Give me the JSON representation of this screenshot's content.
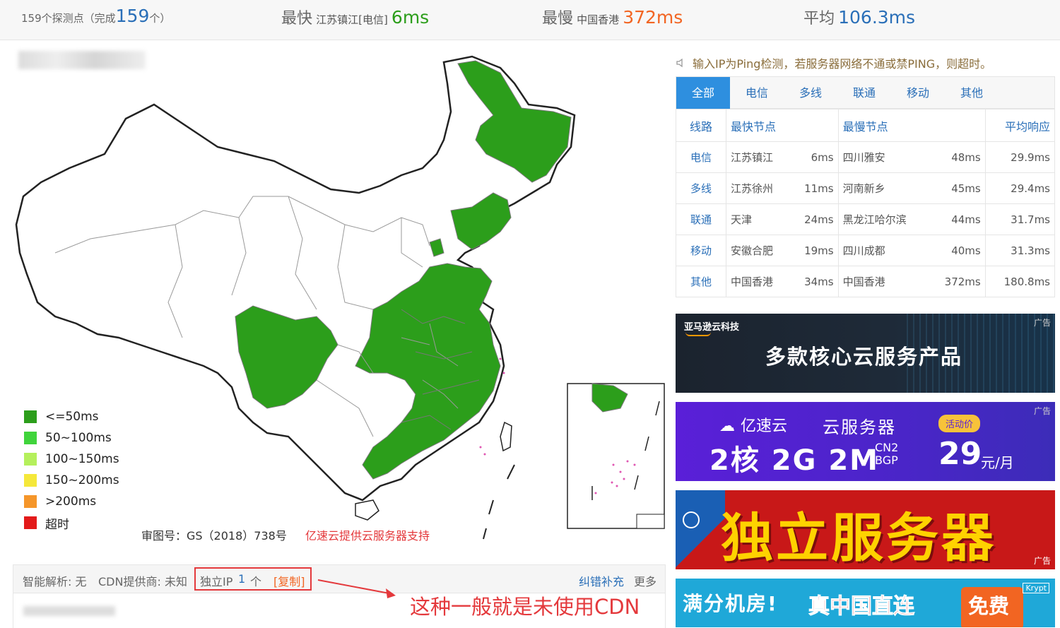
{
  "summary": {
    "count_prefix": "159个探测点（完成",
    "count_value": "159",
    "count_suffix": "个）",
    "fastest_label": "最快",
    "fastest_node": "江苏镇江[电信]",
    "fastest_value": "6ms",
    "slowest_label": "最慢",
    "slowest_node": "中国香港",
    "slowest_value": "372ms",
    "avg_label": "平均",
    "avg_value": "106.3ms"
  },
  "colors": {
    "green": "#2c9e1b",
    "blue": "#2a6fb8",
    "red": "#e4393c",
    "orange": "#f26522"
  },
  "legend": [
    {
      "label": "<=50ms",
      "color": "#2c9e1b"
    },
    {
      "label": "50~100ms",
      "color": "#40d43c"
    },
    {
      "label": "100~150ms",
      "color": "#b5f05c"
    },
    {
      "label": "150~200ms",
      "color": "#f5e83a"
    },
    {
      "label": ">200ms",
      "color": "#f5962a"
    },
    {
      "label": "超时",
      "color": "#e31a1a"
    }
  ],
  "map": {
    "approval": "审图号：GS（2018）738号",
    "sponsor": "亿速云提供云服务器支持"
  },
  "infobar": {
    "dns": "智能解析: 无",
    "cdn": "CDN提供商: 未知",
    "ip_label": "独立IP",
    "ip_count": "1",
    "ip_unit": "个",
    "copy": "[复制]",
    "correct": "纠错补充",
    "more": "更多"
  },
  "annotation": "这种一般就是未使用CDN",
  "notice": "输入IP为Ping检测，若服务器网络不通或禁PING，则超时。",
  "tabs": [
    "全部",
    "电信",
    "多线",
    "联通",
    "移动",
    "其他"
  ],
  "table": {
    "headers": [
      "线路",
      "最快节点",
      "最慢节点",
      "平均响应"
    ],
    "rows": [
      {
        "line": "电信",
        "fast": "江苏镇江",
        "fast_ms": "6ms",
        "slow": "四川雅安",
        "slow_ms": "48ms",
        "avg": "29.9ms"
      },
      {
        "line": "多线",
        "fast": "江苏徐州",
        "fast_ms": "11ms",
        "slow": "河南新乡",
        "slow_ms": "45ms",
        "avg": "29.4ms"
      },
      {
        "line": "联通",
        "fast": "天津",
        "fast_ms": "24ms",
        "slow": "黑龙江哈尔滨",
        "slow_ms": "44ms",
        "avg": "31.7ms"
      },
      {
        "line": "移动",
        "fast": "安徽合肥",
        "fast_ms": "19ms",
        "slow": "四川成都",
        "slow_ms": "40ms",
        "avg": "31.3ms"
      },
      {
        "line": "其他",
        "fast": "中国香港",
        "fast_ms": "34ms",
        "slow": "中国香港",
        "slow_ms": "372ms",
        "avg": "180.8ms"
      }
    ]
  },
  "ads": {
    "ad_tag": "广告",
    "aws_brand": "亚马逊云科技",
    "aws_title": "多款核心云服务产品",
    "yisu_brand": "亿速云",
    "yisu_product": "云服务器",
    "yisu_badge": "活动价",
    "yisu_spec": "2核 2G 2M",
    "yisu_net1": "CN2",
    "yisu_net2": "BGP",
    "yisu_price": "29",
    "yisu_unit": "元/月",
    "ad3_title": "独立服务器",
    "ad4_left": "满分机房!",
    "ad4_mid": "真中国直连",
    "ad4_right": "免费",
    "ad4_corner": "Krypt"
  }
}
